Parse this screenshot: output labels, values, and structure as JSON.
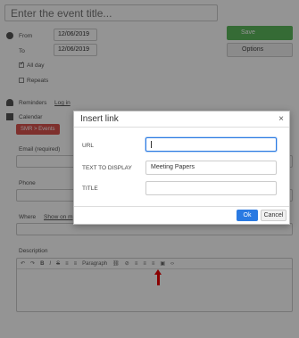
{
  "event": {
    "title_placeholder": "Enter the event title...",
    "from_label": "From",
    "to_label": "To",
    "from_date": "12/06/2019",
    "to_date": "12/06/2019",
    "all_day_label": "All day",
    "repeats_label": "Repeats",
    "reminders_label": "Reminders",
    "reminders_link": "Log in",
    "calendar_label": "Calendar",
    "calendar_tag": "SMR > Events",
    "email_label": "Email (required)",
    "phone_label": "Phone",
    "where_label": "Where",
    "where_link": "Show on m",
    "description_label": "Description",
    "save_label": "Save",
    "options_label": "Options",
    "paragraph_label": "Paragraph"
  },
  "dialog": {
    "title": "Insert link",
    "close": "×",
    "url_label": "URL",
    "url_value": "",
    "text_label": "TEXT TO DISPLAY",
    "text_value": "Meeting Papers",
    "title_label": "TITLE",
    "title_value": "",
    "ok_label": "Ok",
    "cancel_label": "Cancel"
  }
}
